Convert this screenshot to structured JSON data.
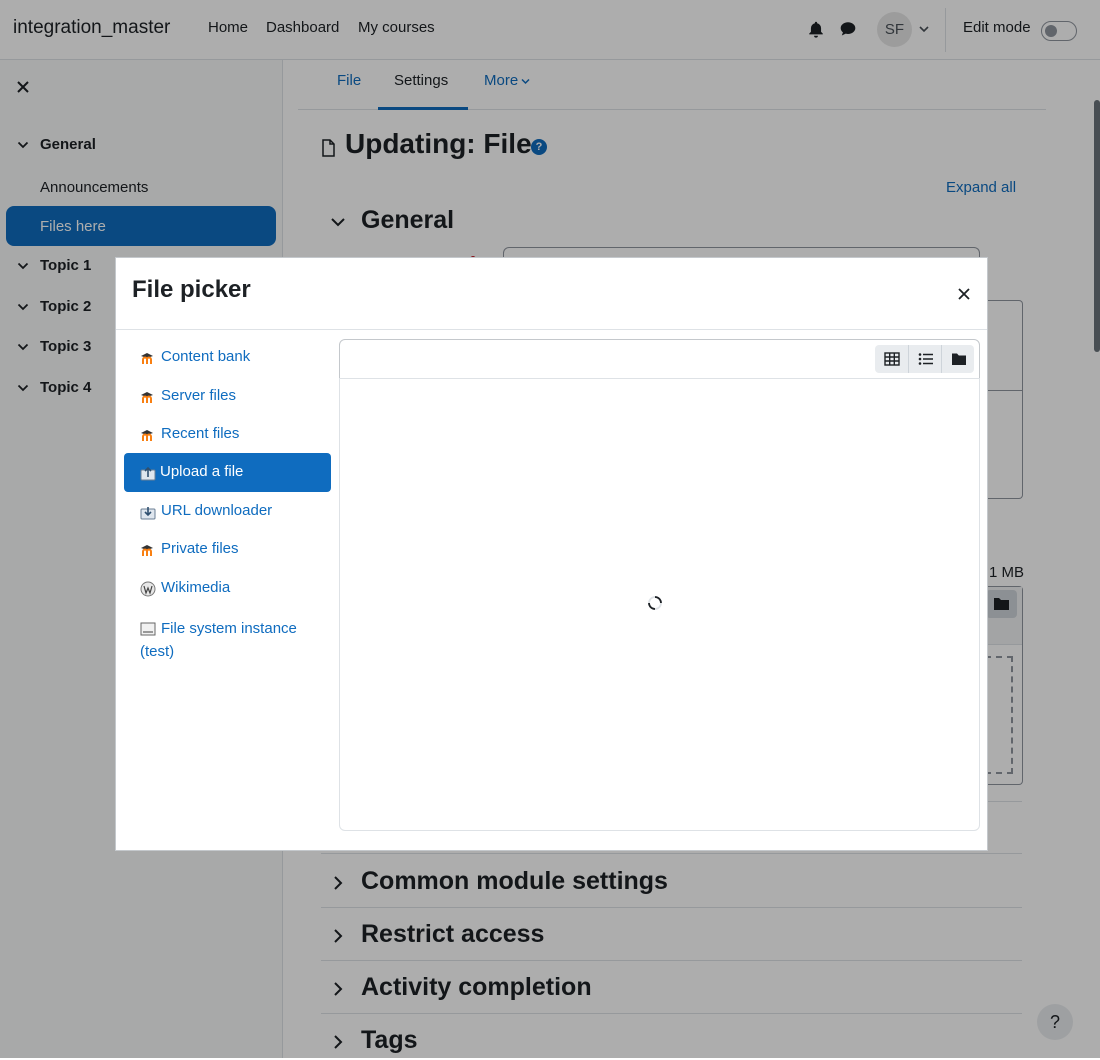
{
  "navbar": {
    "brand": "integration_master",
    "links": [
      "Home",
      "Dashboard",
      "My courses"
    ],
    "avatar_initials": "SF",
    "edit_mode_label": "Edit mode",
    "edit_mode_on": false
  },
  "drawer": {
    "sections": [
      {
        "label": "General",
        "expanded": true,
        "items": [
          "Announcements",
          "Files here"
        ],
        "active_item": "Files here"
      },
      {
        "label": "Topic 1",
        "expanded": true
      },
      {
        "label": "Topic 2",
        "expanded": true
      },
      {
        "label": "Topic 3",
        "expanded": true
      },
      {
        "label": "Topic 4",
        "expanded": true
      }
    ]
  },
  "page": {
    "tabs": [
      "File",
      "Settings",
      "More"
    ],
    "active_tab": "Settings",
    "title": "Updating: File",
    "help_symbol": "?",
    "expand_all": "Expand all",
    "max_size_fragment": "1 MB",
    "sections": [
      "General",
      "Common module settings",
      "Restrict access",
      "Activity completion",
      "Tags"
    ],
    "help_button": "?"
  },
  "file_picker": {
    "title": "File picker",
    "repositories": [
      {
        "label": "Content bank",
        "icon": "moodle-icon"
      },
      {
        "label": "Server files",
        "icon": "moodle-icon"
      },
      {
        "label": "Recent files",
        "icon": "moodle-icon"
      },
      {
        "label": "Upload a file",
        "icon": "upload-icon",
        "active": true
      },
      {
        "label": "URL downloader",
        "icon": "url-downloader-icon"
      },
      {
        "label": "Private files",
        "icon": "moodle-icon"
      },
      {
        "label": "Wikimedia",
        "icon": "wikimedia-icon"
      },
      {
        "label": "File system instance (test)",
        "icon": "filesystem-icon"
      }
    ],
    "view_modes": [
      "grid-icon",
      "list-icon",
      "folder-icon"
    ],
    "loading": true
  },
  "colors": {
    "primary": "#0f6cbf",
    "text": "#1d2125",
    "moodle_orange": "#f98012"
  }
}
